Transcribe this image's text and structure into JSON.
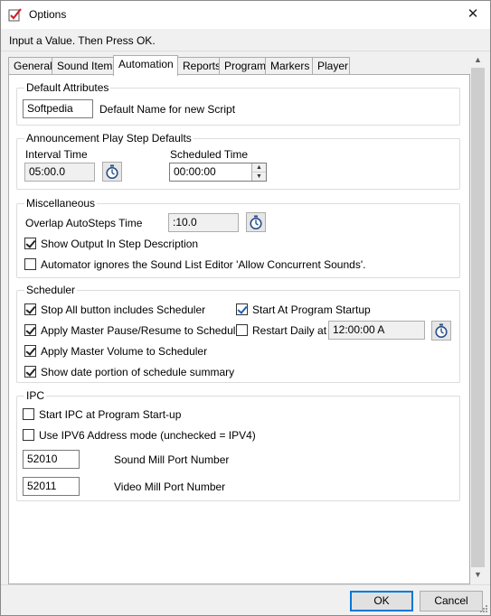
{
  "window": {
    "title": "Options",
    "close_glyph": "✕"
  },
  "prompt": "Input a Value. Then Press OK.",
  "tabs": [
    {
      "label": "General"
    },
    {
      "label": "Sound Item"
    },
    {
      "label": "Automation",
      "active": true
    },
    {
      "label": "Reports"
    },
    {
      "label": "Program"
    },
    {
      "label": "Markers"
    },
    {
      "label": "Player"
    }
  ],
  "default_attributes": {
    "title": "Default Attributes",
    "name_value": "Softpedia",
    "name_label": "Default Name for new Script"
  },
  "announcement": {
    "title": "Announcement Play Step Defaults",
    "interval_label": "Interval Time",
    "interval_value": "05:00.0",
    "scheduled_label": "Scheduled Time",
    "scheduled_value": "00:00:00"
  },
  "miscellaneous": {
    "title": "Miscellaneous",
    "overlap_label": "Overlap AutoSteps Time",
    "overlap_value": ":10.0",
    "show_output": {
      "label": "Show Output In Step Description",
      "checked": true
    },
    "automator_ignores": {
      "label": "Automator ignores the Sound List Editor 'Allow Concurrent Sounds'.",
      "checked": false
    }
  },
  "scheduler": {
    "title": "Scheduler",
    "stop_all": {
      "label": "Stop All button includes Scheduler",
      "checked": true
    },
    "apply_pause": {
      "label": "Apply Master Pause/Resume to Scheduler",
      "checked": true
    },
    "apply_volume": {
      "label": "Apply Master Volume to Scheduler",
      "checked": true
    },
    "show_date": {
      "label": "Show date portion of schedule summary",
      "checked": true
    },
    "start_at_startup": {
      "label": "Start At Program Startup",
      "checked": true
    },
    "restart_daily": {
      "label": "Restart Daily at",
      "checked": false
    },
    "restart_time": "12:00:00 A"
  },
  "ipc": {
    "title": "IPC",
    "start_ipc": {
      "label": "Start IPC at Program Start-up",
      "checked": false
    },
    "use_ipv6": {
      "label": "Use IPV6 Address mode (unchecked = IPV4)",
      "checked": false
    },
    "sound_port_value": "52010",
    "sound_port_label": "Sound Mill Port Number",
    "video_port_value": "52011",
    "video_port_label": "Video Mill Port Number"
  },
  "buttons": {
    "ok": "OK",
    "cancel": "Cancel"
  },
  "icons": {
    "app": "checklist-icon",
    "timer": "stopwatch-icon"
  },
  "colors": {
    "accent": "#0078d7",
    "check_blue": "#1a5fb4"
  }
}
